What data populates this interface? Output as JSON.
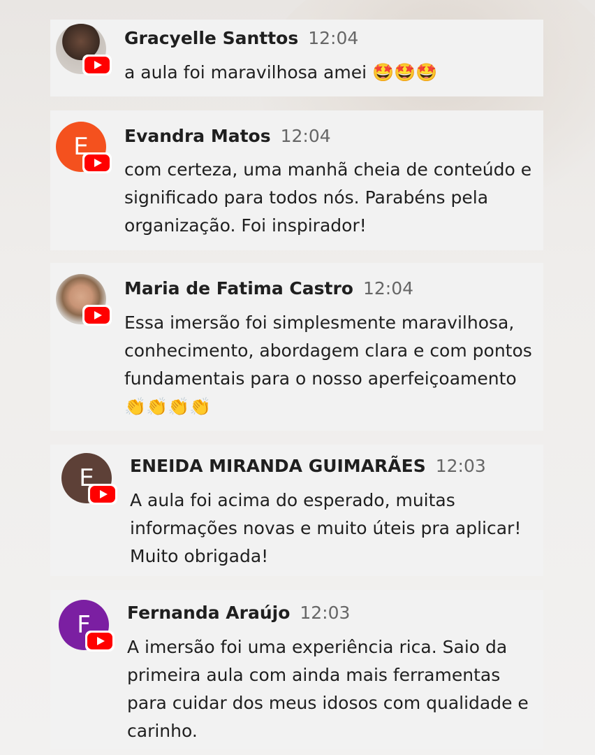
{
  "messages": [
    {
      "name": "Gracyelle Santtos",
      "time": "12:04",
      "text": "a aula foi maravilhosa amei 🤩🤩🤩",
      "avatar": {
        "type": "photo",
        "icon": "user-photo"
      }
    },
    {
      "name": "Evandra Matos",
      "time": "12:04",
      "text": "com certeza, uma manhã cheia de conteúdo e significado para todos nós. Parabéns pela organização. Foi inspirador!",
      "avatar": {
        "type": "initial",
        "initial": "E",
        "color": "#f4511e"
      }
    },
    {
      "name": "Maria de Fatima Castro",
      "time": "12:04",
      "text": "Essa imersão foi simplesmente maravilhosa, conhecimento, abordagem clara e com pontos fundamentais para o nosso aperfeiçoamento 👏👏👏👏",
      "avatar": {
        "type": "photo",
        "icon": "user-photo"
      }
    },
    {
      "name": "ENEIDA MIRANDA GUIMARÃES",
      "time": "12:03",
      "text": "A aula foi acima do esperado, muitas informações novas e muito úteis pra aplicar! Muito obrigada!",
      "avatar": {
        "type": "initial",
        "initial": "E",
        "color": "#5d4037"
      }
    },
    {
      "name": "Fernanda Araújo",
      "time": "12:03",
      "text": "A imersão foi uma experiência rica. Saio da primeira aula com ainda mais ferramentas para cuidar dos meus idosos com qualidade e carinho.",
      "avatar": {
        "type": "initial",
        "initial": "F",
        "color": "#7b1fa2"
      }
    }
  ],
  "badge_icon": "youtube-icon"
}
